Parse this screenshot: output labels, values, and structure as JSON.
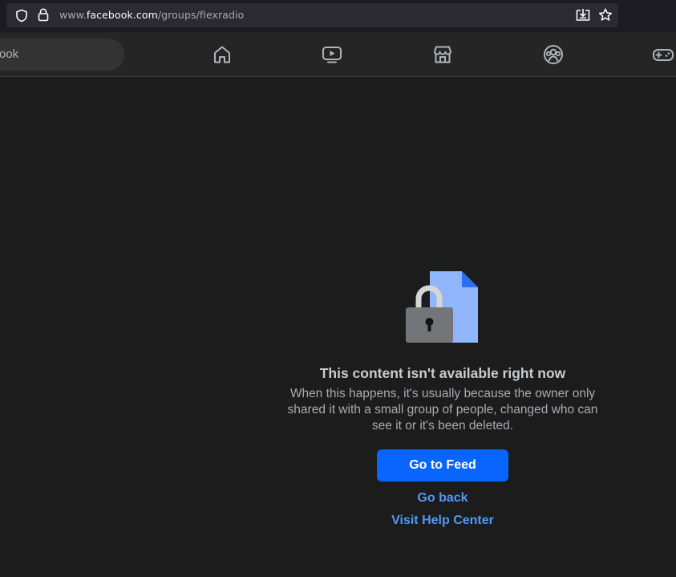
{
  "browser": {
    "url_prefix": "www.",
    "url_domain": "facebook.com",
    "url_path": "/groups/flexradio",
    "icons": [
      "shield-icon",
      "lock-icon",
      "save-to-pocket-icon",
      "bookmark-star-icon"
    ]
  },
  "facebook_nav": {
    "search_text": "ook",
    "items": [
      {
        "icon": "home-icon"
      },
      {
        "icon": "video-icon"
      },
      {
        "icon": "marketplace-icon"
      },
      {
        "icon": "groups-icon"
      },
      {
        "icon": "gaming-icon"
      }
    ]
  },
  "error": {
    "title": "This content isn't available right now",
    "description_lines": [
      "When this happens, it's usually because the owner only",
      "shared it with a small group of people, changed who can",
      "see it or it's been deleted."
    ],
    "primary_button": "Go to Feed",
    "back_link": "Go back",
    "help_link": "Visit Help Center"
  },
  "colors": {
    "background": "#1c1c1d",
    "primary_button": "#0866ff",
    "link": "#4f9af5"
  }
}
